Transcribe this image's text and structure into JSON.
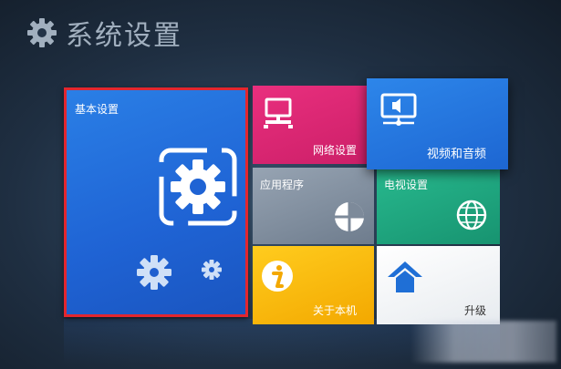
{
  "header": {
    "title": "系统设置",
    "icon": "gear-icon"
  },
  "tiles": {
    "basic": {
      "label": "基本设置",
      "color": "#1f63d4"
    },
    "network": {
      "label": "网络设置",
      "color": "#e92f7e"
    },
    "av": {
      "label": "视频和音频",
      "color": "#2d86ea"
    },
    "apps": {
      "label": "应用程序",
      "color": "#7d8a9a"
    },
    "tv": {
      "label": "电视设置",
      "color": "#28b98e"
    },
    "about": {
      "label": "关于本机",
      "color": "#ffcc1e"
    },
    "upgrade": {
      "label": "升级",
      "color": "#ffffff"
    }
  },
  "selection": {
    "selected_tile": "basic",
    "highlight_color": "#e3262e"
  }
}
